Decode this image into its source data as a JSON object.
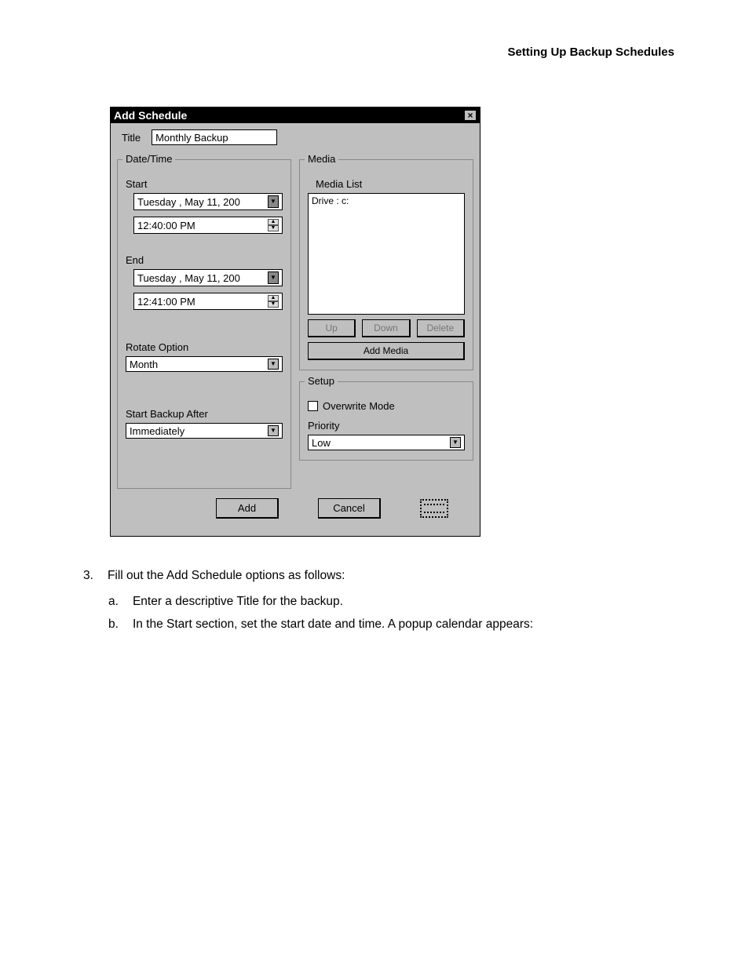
{
  "header": {
    "section_title": "Setting Up Backup Schedules"
  },
  "dialog": {
    "title": "Add Schedule",
    "close": "×",
    "title_field": {
      "label": "Title",
      "value": "Monthly Backup"
    },
    "datetime": {
      "legend": "Date/Time",
      "start": {
        "label": "Start",
        "date": "Tuesday  ,    May      11, 200",
        "time": "12:40:00 PM"
      },
      "end": {
        "label": "End",
        "date": "Tuesday  ,    May      11, 200",
        "time": "12:41:00 PM"
      },
      "rotate": {
        "label": "Rotate Option",
        "value": "Month"
      },
      "start_after": {
        "label": "Start Backup After",
        "value": "Immediately"
      }
    },
    "media": {
      "legend": "Media",
      "list_label": "Media List",
      "list_item": "Drive : c:",
      "up": "Up",
      "down": "Down",
      "delete": "Delete",
      "add_media": "Add Media"
    },
    "setup": {
      "legend": "Setup",
      "overwrite": "Overwrite Mode",
      "priority_label": "Priority",
      "priority_value": "Low"
    },
    "buttons": {
      "add": "Add",
      "cancel": "Cancel"
    }
  },
  "instructions": {
    "step_num": "3.",
    "step_text": "Fill out the Add Schedule options as follows:",
    "a_num": "a.",
    "a_text": "Enter a descriptive Title for the backup.",
    "b_num": "b.",
    "b_text": "In the Start section, set the start date and time. A popup calendar appears:"
  }
}
